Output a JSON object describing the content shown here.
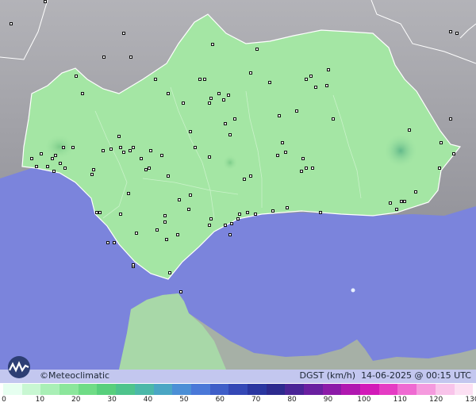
{
  "brand": {
    "text": "©Meteoclimatic"
  },
  "info": {
    "variable": "DGST (km/h)",
    "datetime": "14-06-2025 @ 00:15 UTC"
  },
  "scale": {
    "ticks": [
      "0",
      "10",
      "20",
      "30",
      "40",
      "50",
      "60",
      "70",
      "80",
      "90",
      "100",
      "110",
      "120",
      "130"
    ],
    "colors": [
      "#e6fff0",
      "#c8f7d2",
      "#a9efb6",
      "#8be69b",
      "#6fdc86",
      "#58cf7c",
      "#4ec48c",
      "#4bb8a8",
      "#4aa6c4",
      "#4b8fd6",
      "#4a78d8",
      "#3f5ec8",
      "#3448b6",
      "#2a36a0",
      "#2d2a8e",
      "#4a2496",
      "#6a1fa0",
      "#8c1aa8",
      "#b018b0",
      "#d21ab8",
      "#e53cc4",
      "#ef6ad2",
      "#f59ade",
      "#f9c4ea",
      "#fce0f3"
    ]
  },
  "colors": {
    "sea": "#7b84dc",
    "land_gray": "#9a9aa0",
    "andalucia": "#a4e6a4",
    "morocco": "#a8d8a8"
  }
}
